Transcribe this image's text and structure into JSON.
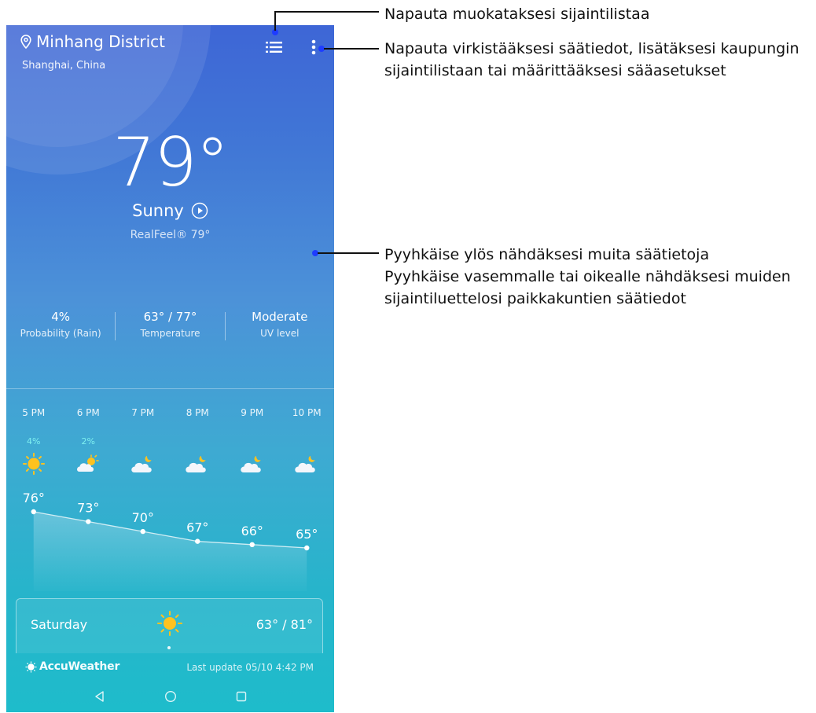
{
  "location": {
    "city": "Minhang District",
    "region": "Shanghai, China",
    "pin_icon": "location-pin-icon"
  },
  "toolbar": {
    "list_icon": "location-list-icon",
    "more_icon": "more-vertical-icon"
  },
  "current": {
    "temperature": "79°",
    "condition": "Sunny",
    "play_icon": "play-circle-icon",
    "realfeel": "RealFeel® 79°"
  },
  "stats": [
    {
      "value": "4%",
      "label": "Probability (Rain)"
    },
    {
      "value": "63° / 77°",
      "label": "Temperature"
    },
    {
      "value": "Moderate",
      "label": "UV level"
    }
  ],
  "hourly": [
    {
      "time": "5 PM",
      "precip": "4%",
      "icon": "sunny-icon",
      "temp": 76
    },
    {
      "time": "6 PM",
      "precip": "2%",
      "icon": "partly-cloudy-icon",
      "temp": 73
    },
    {
      "time": "7 PM",
      "precip": "",
      "icon": "cloudy-moon-icon",
      "temp": 70
    },
    {
      "time": "8 PM",
      "precip": "",
      "icon": "cloudy-moon-icon",
      "temp": 67
    },
    {
      "time": "9 PM",
      "precip": "",
      "icon": "cloudy-moon-icon",
      "temp": 66
    },
    {
      "time": "10 PM",
      "precip": "",
      "icon": "cloudy-moon-icon",
      "temp": 65
    }
  ],
  "hourly_temp_labels": [
    "76°",
    "73°",
    "70°",
    "67°",
    "66°",
    "65°"
  ],
  "daily": {
    "day": "Saturday",
    "icon": "sunny-icon",
    "range": "63° / 81°"
  },
  "footer": {
    "brand": "AccuWeather",
    "brand_icon": "accuweather-sun-icon",
    "last_update": "Last update 05/10 4:42 PM"
  },
  "nav": {
    "back_icon": "back-triangle-icon",
    "home_icon": "home-circle-icon",
    "recents_icon": "recents-square-icon"
  },
  "callouts": {
    "list": "Napauta muokataksesi sijaintilistaa",
    "menu_line1": "Napauta virkistääksesi säätiedot, lisätäksesi kaupungin",
    "menu_line2": "sijaintilistaan tai määrittääksesi sääasetukset",
    "swipe_line1": "Pyyhkäise ylös nähdäksesi muita säätietoja",
    "swipe_line2": "Pyyhkäise vasemmalle tai oikealle nähdäksesi muiden",
    "swipe_line3": "sijaintiluettelosi paikkakuntien säätiedot"
  },
  "colors": {
    "sky_top": "#3e66d6",
    "sky_bottom": "#1ebccb",
    "precip": "#7ef0f0",
    "sun": "#ffc21f",
    "callout_dot": "#1e3cff"
  }
}
